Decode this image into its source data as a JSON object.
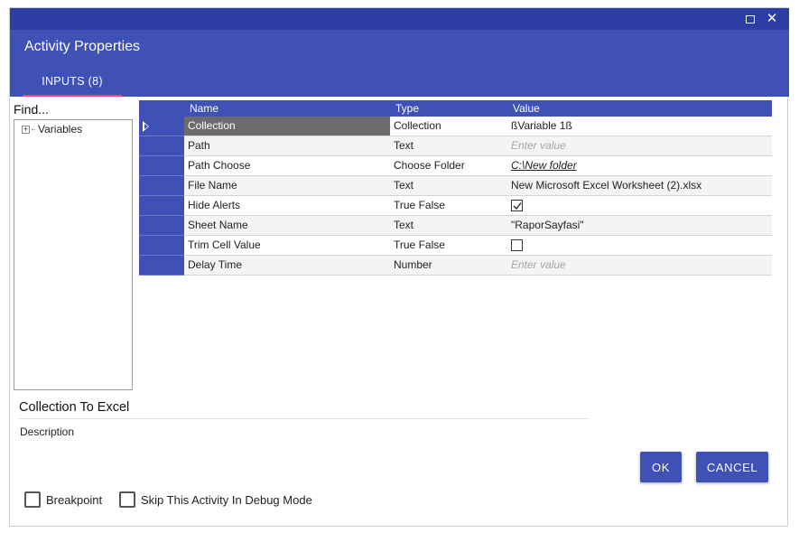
{
  "window": {
    "title": "Activity Properties",
    "tab_label": "INPUTS (8)",
    "accent_color": "#3f51b5",
    "titlebar_color": "#2c3ea6",
    "tab_indicator_color": "#ff4081"
  },
  "sidebar": {
    "find_label": "Find...",
    "tree_items": [
      {
        "label": "Variables",
        "expander": "+"
      }
    ]
  },
  "grid": {
    "headers": {
      "name": "Name",
      "type": "Type",
      "value": "Value"
    },
    "rows": [
      {
        "name": "Collection",
        "type": "Collection",
        "value": "ßVariable 1ß",
        "kind": "text",
        "selected": true
      },
      {
        "name": "Path",
        "type": "Text",
        "value": "",
        "placeholder": "Enter value",
        "kind": "placeholder"
      },
      {
        "name": "Path Choose",
        "type": "Choose Folder",
        "value": "C:\\New folder",
        "kind": "link"
      },
      {
        "name": "File Name",
        "type": "Text",
        "value": "New Microsoft Excel Worksheet (2).xlsx",
        "kind": "text"
      },
      {
        "name": "Hide Alerts",
        "type": "True False",
        "value": true,
        "kind": "checkbox"
      },
      {
        "name": "Sheet Name",
        "type": "Text",
        "value": "\"RaporSayfasi\"",
        "kind": "text"
      },
      {
        "name": "Trim Cell Value",
        "type": "True False",
        "value": false,
        "kind": "checkbox"
      },
      {
        "name": "Delay Time",
        "type": "Number",
        "value": "",
        "placeholder": "Enter value",
        "kind": "placeholder"
      }
    ]
  },
  "footer": {
    "activity_name": "Collection To Excel",
    "description_label": "Description",
    "ok_label": "OK",
    "cancel_label": "CANCEL",
    "breakpoint_label": "Breakpoint",
    "breakpoint_checked": false,
    "skip_label": "Skip This Activity In Debug Mode",
    "skip_checked": false
  },
  "icons": [
    "maximize-icon",
    "close-icon",
    "tree-expand-icon",
    "row-pointer-icon",
    "checkmark-icon"
  ]
}
